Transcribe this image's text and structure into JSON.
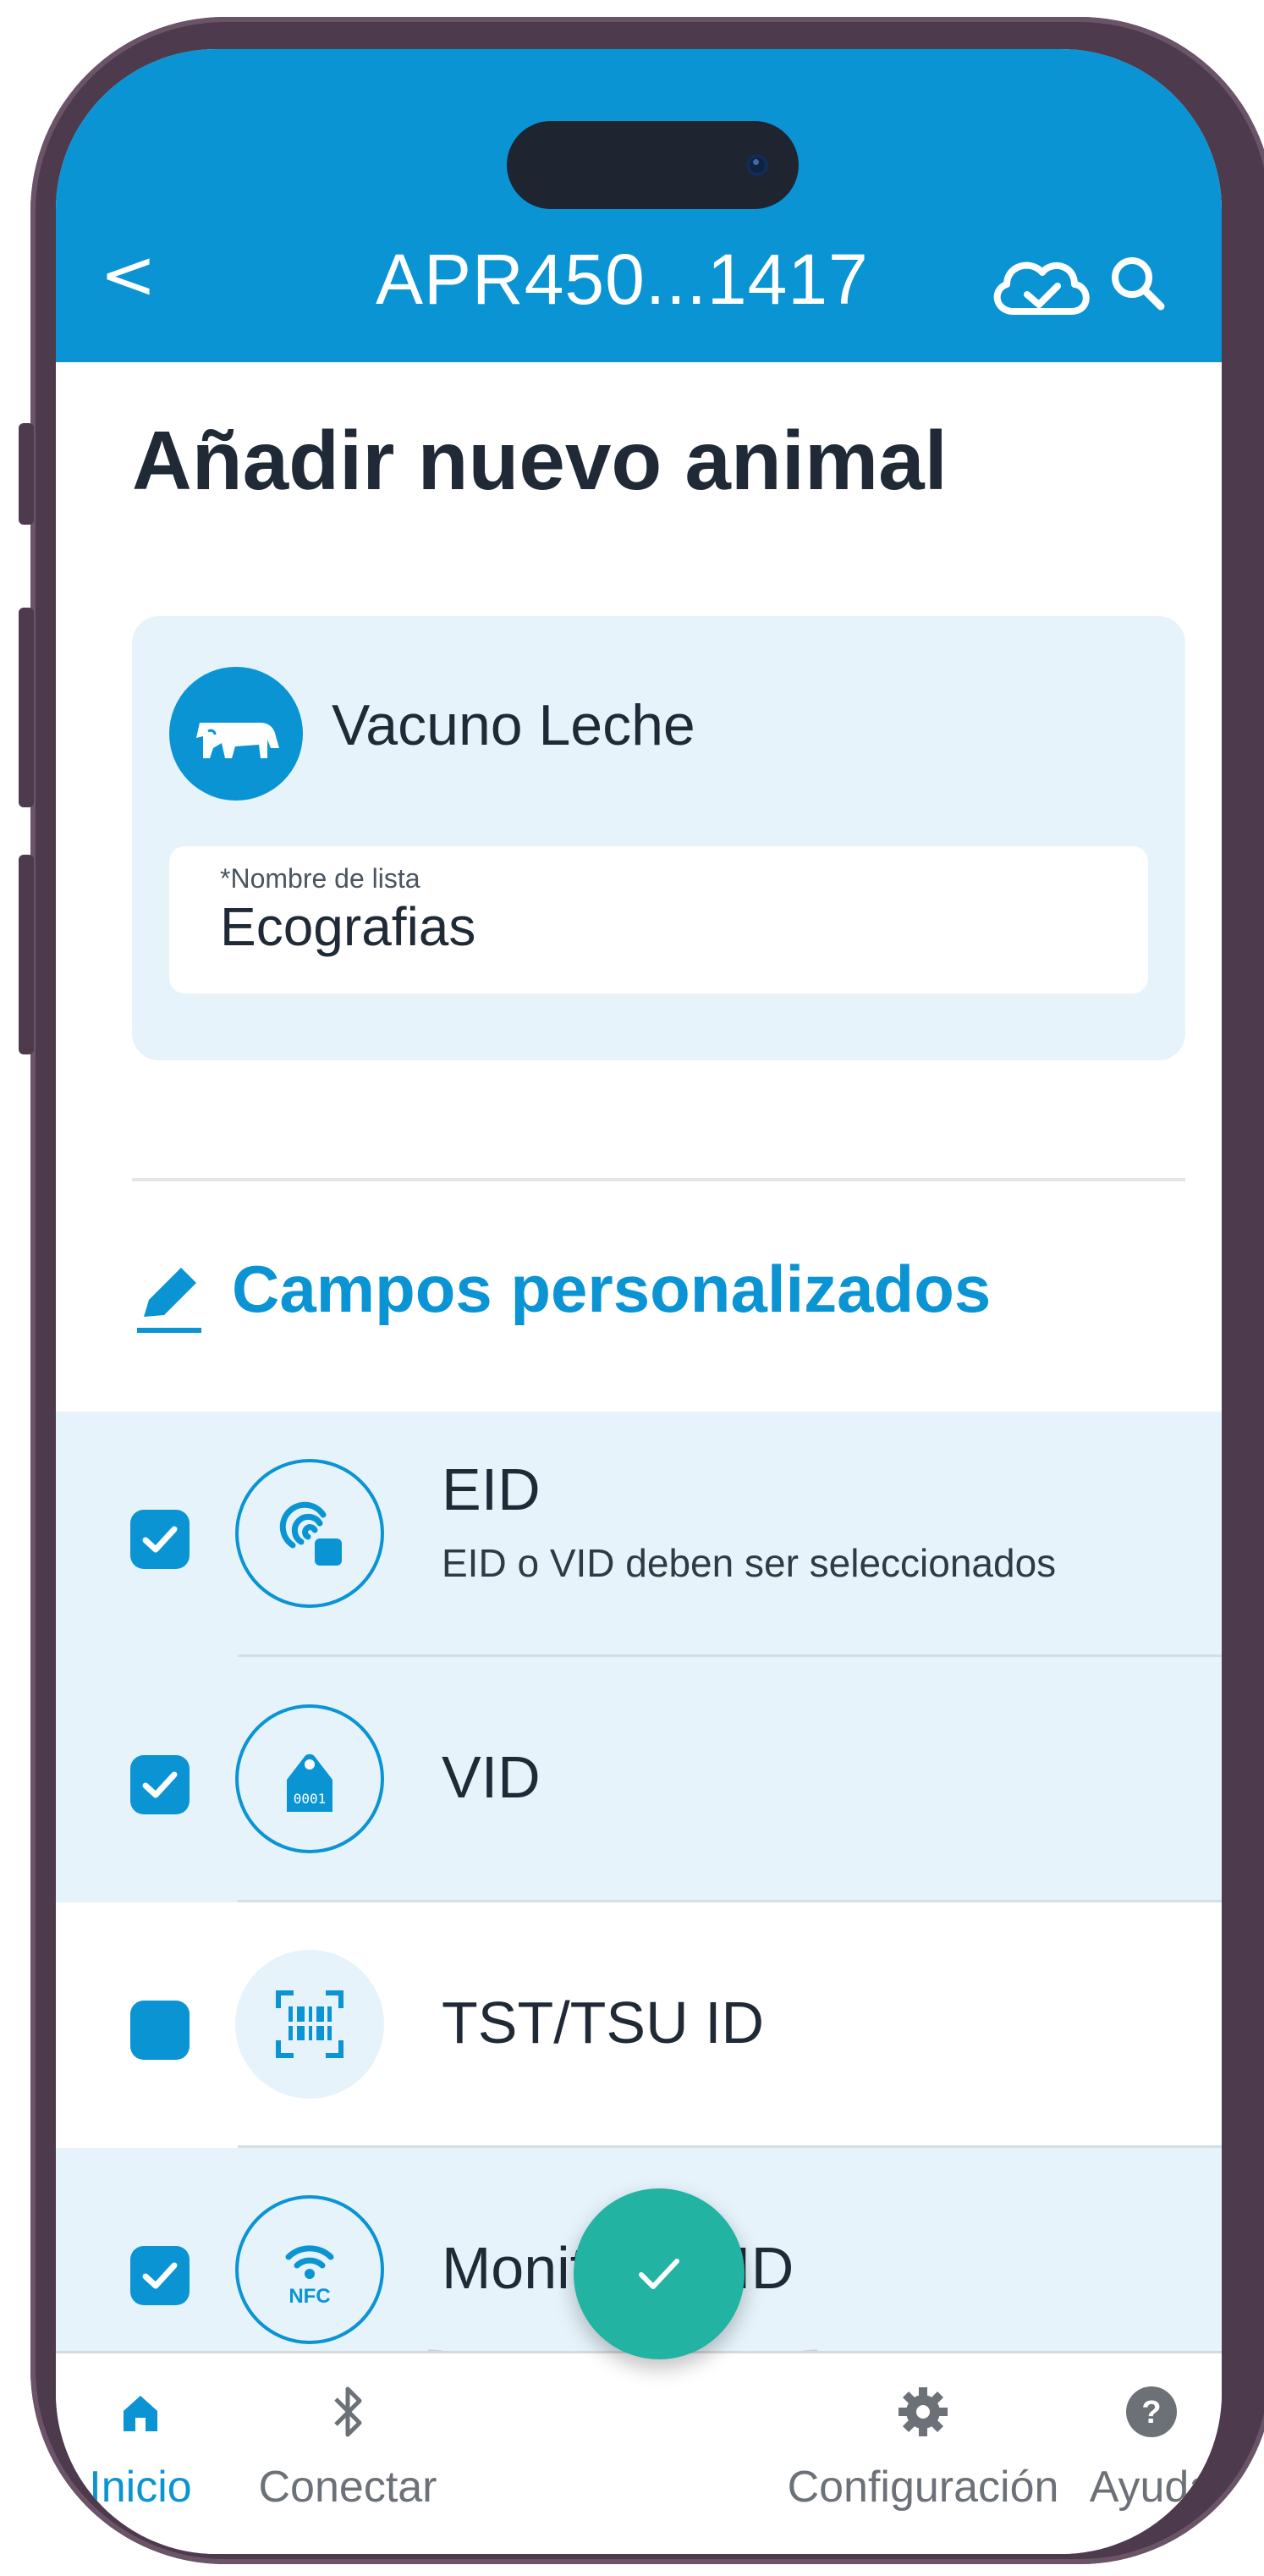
{
  "header": {
    "back_label": "<",
    "title": "APR450...1417"
  },
  "page": {
    "title": "Añadir nuevo animal"
  },
  "animal_type": {
    "label": "Vacuno Leche",
    "icon": "cow-icon"
  },
  "list_field": {
    "label": "*Nombre de lista",
    "value": "Ecografias"
  },
  "section": {
    "title": "Campos personalizados",
    "icon": "pencil-icon"
  },
  "fields": [
    {
      "title": "EID",
      "subtitle": "EID o VID deben ser seleccionados",
      "checked": true,
      "icon": "rfid-icon"
    },
    {
      "title": "VID",
      "subtitle": "",
      "checked": true,
      "icon": "ear-tag-icon",
      "tag_text": "0001"
    },
    {
      "title": "TST/TSU ID",
      "subtitle": "",
      "checked": false,
      "icon": "barcode-icon"
    },
    {
      "title": "Monitoring ID",
      "subtitle": "",
      "checked": true,
      "icon": "nfc-icon",
      "badge_text": "NFC"
    }
  ],
  "nav": {
    "items": [
      {
        "label": "Inicio",
        "icon": "home-icon",
        "active": true
      },
      {
        "label": "Conectar",
        "icon": "bluetooth-icon",
        "active": false
      },
      {
        "label": "Configuración",
        "icon": "gear-icon",
        "active": false
      },
      {
        "label": "Ayuda",
        "icon": "help-icon",
        "active": false
      }
    ]
  },
  "fab": {
    "icon": "check-icon"
  },
  "colors": {
    "primary": "#0a94d4",
    "selected_row": "#e6f3fb",
    "fab": "#22b3a3",
    "text": "#1f2a36"
  }
}
